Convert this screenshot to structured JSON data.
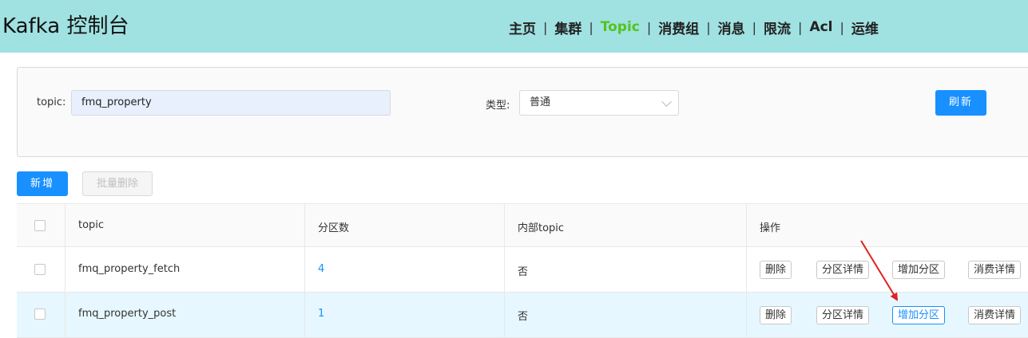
{
  "app": {
    "title": "Kafka 控制台"
  },
  "nav": {
    "items": [
      {
        "label": "主页"
      },
      {
        "label": "集群"
      },
      {
        "label": "Topic"
      },
      {
        "label": "消费组"
      },
      {
        "label": "消息"
      },
      {
        "label": "限流"
      },
      {
        "label": "Acl"
      },
      {
        "label": "运维"
      }
    ],
    "separator": "|",
    "active": "Topic",
    "active_color": "#52c41a"
  },
  "filters": {
    "topic_label": "topic:",
    "topic_value": "fmq_property",
    "type_label": "类型:",
    "type_value": "普通",
    "refresh_label": "刷新"
  },
  "actions": {
    "add_label": "新增",
    "batch_delete_label": "批量删除"
  },
  "table": {
    "columns": [
      "topic",
      "分区数",
      "内部topic",
      "操作"
    ],
    "rows": [
      {
        "topic": "fmq_property_fetch",
        "partitions": "4",
        "internal": "否"
      },
      {
        "topic": "fmq_property_post",
        "partitions": "1",
        "internal": "否"
      }
    ],
    "row_actions": [
      "删除",
      "分区详情",
      "增加分区",
      "消费详情"
    ]
  },
  "colors": {
    "header_bg": "#a0e1e1",
    "primary": "#1890ff",
    "annotation_arrow": "#e02020"
  }
}
